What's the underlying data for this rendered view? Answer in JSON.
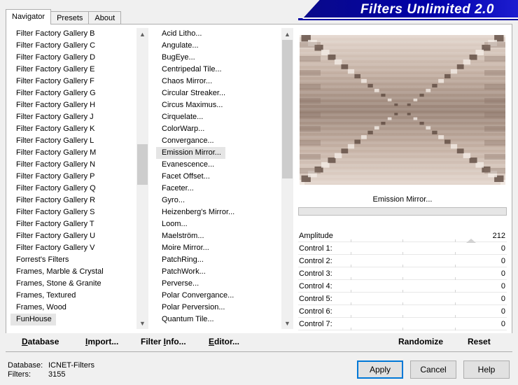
{
  "tabs": [
    "Navigator",
    "Presets",
    "About"
  ],
  "app_title": "Filters Unlimited 2.0",
  "categories": {
    "items": [
      "Filter Factory Gallery B",
      "Filter Factory Gallery C",
      "Filter Factory Gallery D",
      "Filter Factory Gallery E",
      "Filter Factory Gallery F",
      "Filter Factory Gallery G",
      "Filter Factory Gallery H",
      "Filter Factory Gallery J",
      "Filter Factory Gallery K",
      "Filter Factory Gallery L",
      "Filter Factory Gallery M",
      "Filter Factory Gallery N",
      "Filter Factory Gallery P",
      "Filter Factory Gallery Q",
      "Filter Factory Gallery R",
      "Filter Factory Gallery S",
      "Filter Factory Gallery T",
      "Filter Factory Gallery U",
      "Filter Factory Gallery V",
      "Forrest's Filters",
      "Frames, Marble & Crystal",
      "Frames, Stone & Granite",
      "Frames, Textured",
      "Frames, Wood",
      "FunHouse"
    ],
    "selected_index": 24
  },
  "filters": {
    "items": [
      "Acid Litho...",
      "Angulate...",
      "BugEye...",
      "Centripedal Tile...",
      "Chaos Mirror...",
      "Circular Streaker...",
      "Circus Maximus...",
      "Cirquelate...",
      "ColorWarp...",
      "Convergance...",
      "Emission Mirror...",
      "Evanescence...",
      "Facet Offset...",
      "Faceter...",
      "Gyro...",
      "Heizenberg's Mirror...",
      "Loom...",
      "Maelström...",
      "Moire Mirror...",
      "PatchRing...",
      "PatchWork...",
      "Perverse...",
      "Polar Convergance...",
      "Polar Perversion...",
      "Quantum Tile..."
    ],
    "selected_index": 10
  },
  "preview": {
    "filter_name": "Emission Mirror..."
  },
  "controls": [
    {
      "label": "Amplitude",
      "value": "212",
      "level": 0.83
    },
    {
      "label": "Control 1:",
      "value": "0",
      "level": 0
    },
    {
      "label": "Control 2:",
      "value": "0",
      "level": 0
    },
    {
      "label": "Control 3:",
      "value": "0",
      "level": 0
    },
    {
      "label": "Control 4:",
      "value": "0",
      "level": 0
    },
    {
      "label": "Control 5:",
      "value": "0",
      "level": 0
    },
    {
      "label": "Control 6:",
      "value": "0",
      "level": 0
    },
    {
      "label": "Control 7:",
      "value": "0",
      "level": 0
    }
  ],
  "bottom_buttons": {
    "database": {
      "mnemonic": "D",
      "rest": "atabase"
    },
    "import": {
      "mnemonic": "I",
      "rest": "mport..."
    },
    "filter_info": {
      "pre": "Filter ",
      "mnemonic": "I",
      "rest": "nfo..."
    },
    "editor": {
      "mnemonic": "E",
      "rest": "ditor..."
    },
    "randomize": "Randomize",
    "reset": "Reset"
  },
  "status": {
    "database_label": "Database:",
    "database_value": "ICNET-Filters",
    "filters_label": "Filters:",
    "filters_value": "3155"
  },
  "dialog_buttons": {
    "apply": "Apply",
    "cancel": "Cancel",
    "help": "Help"
  }
}
